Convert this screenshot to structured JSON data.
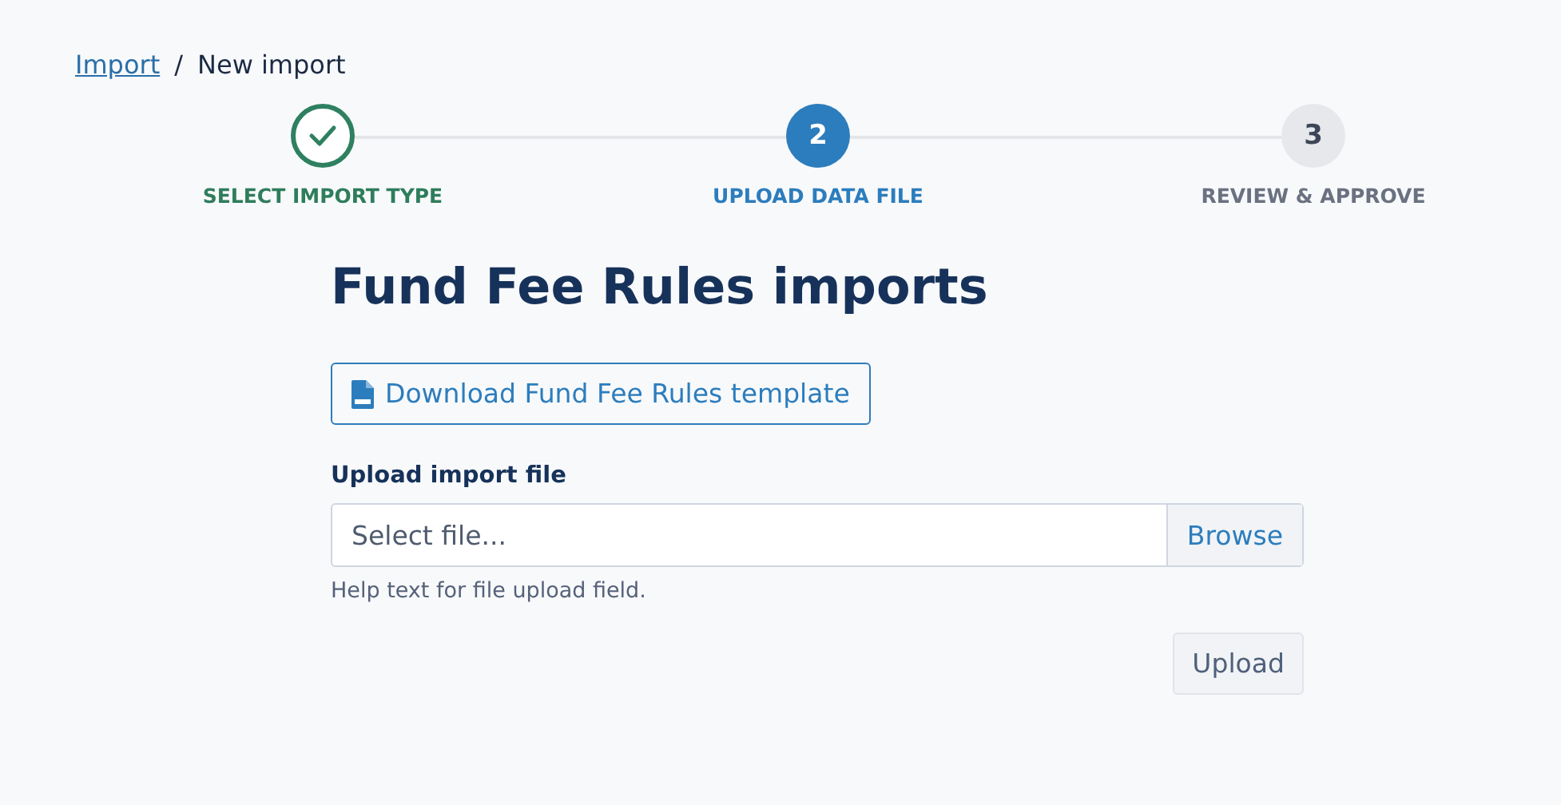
{
  "breadcrumb": {
    "link": "Import",
    "separator": "/",
    "current": "New import"
  },
  "steps": [
    {
      "label": "SELECT IMPORT TYPE",
      "completed": true,
      "selected": false
    },
    {
      "number": "2",
      "label": "UPLOAD DATA FILE",
      "completed": false,
      "selected": true
    },
    {
      "number": "3",
      "label": "REVIEW & APPROVE",
      "completed": false,
      "selected": false
    }
  ],
  "title": "Fund Fee Rules imports",
  "download_button": "Download Fund Fee Rules template",
  "upload_field": {
    "label": "Upload import file",
    "placeholder": "Select file...",
    "browse": "Browse",
    "help": "Help text for file upload field."
  },
  "upload_button": {
    "label": "Upload",
    "disabled": true
  }
}
